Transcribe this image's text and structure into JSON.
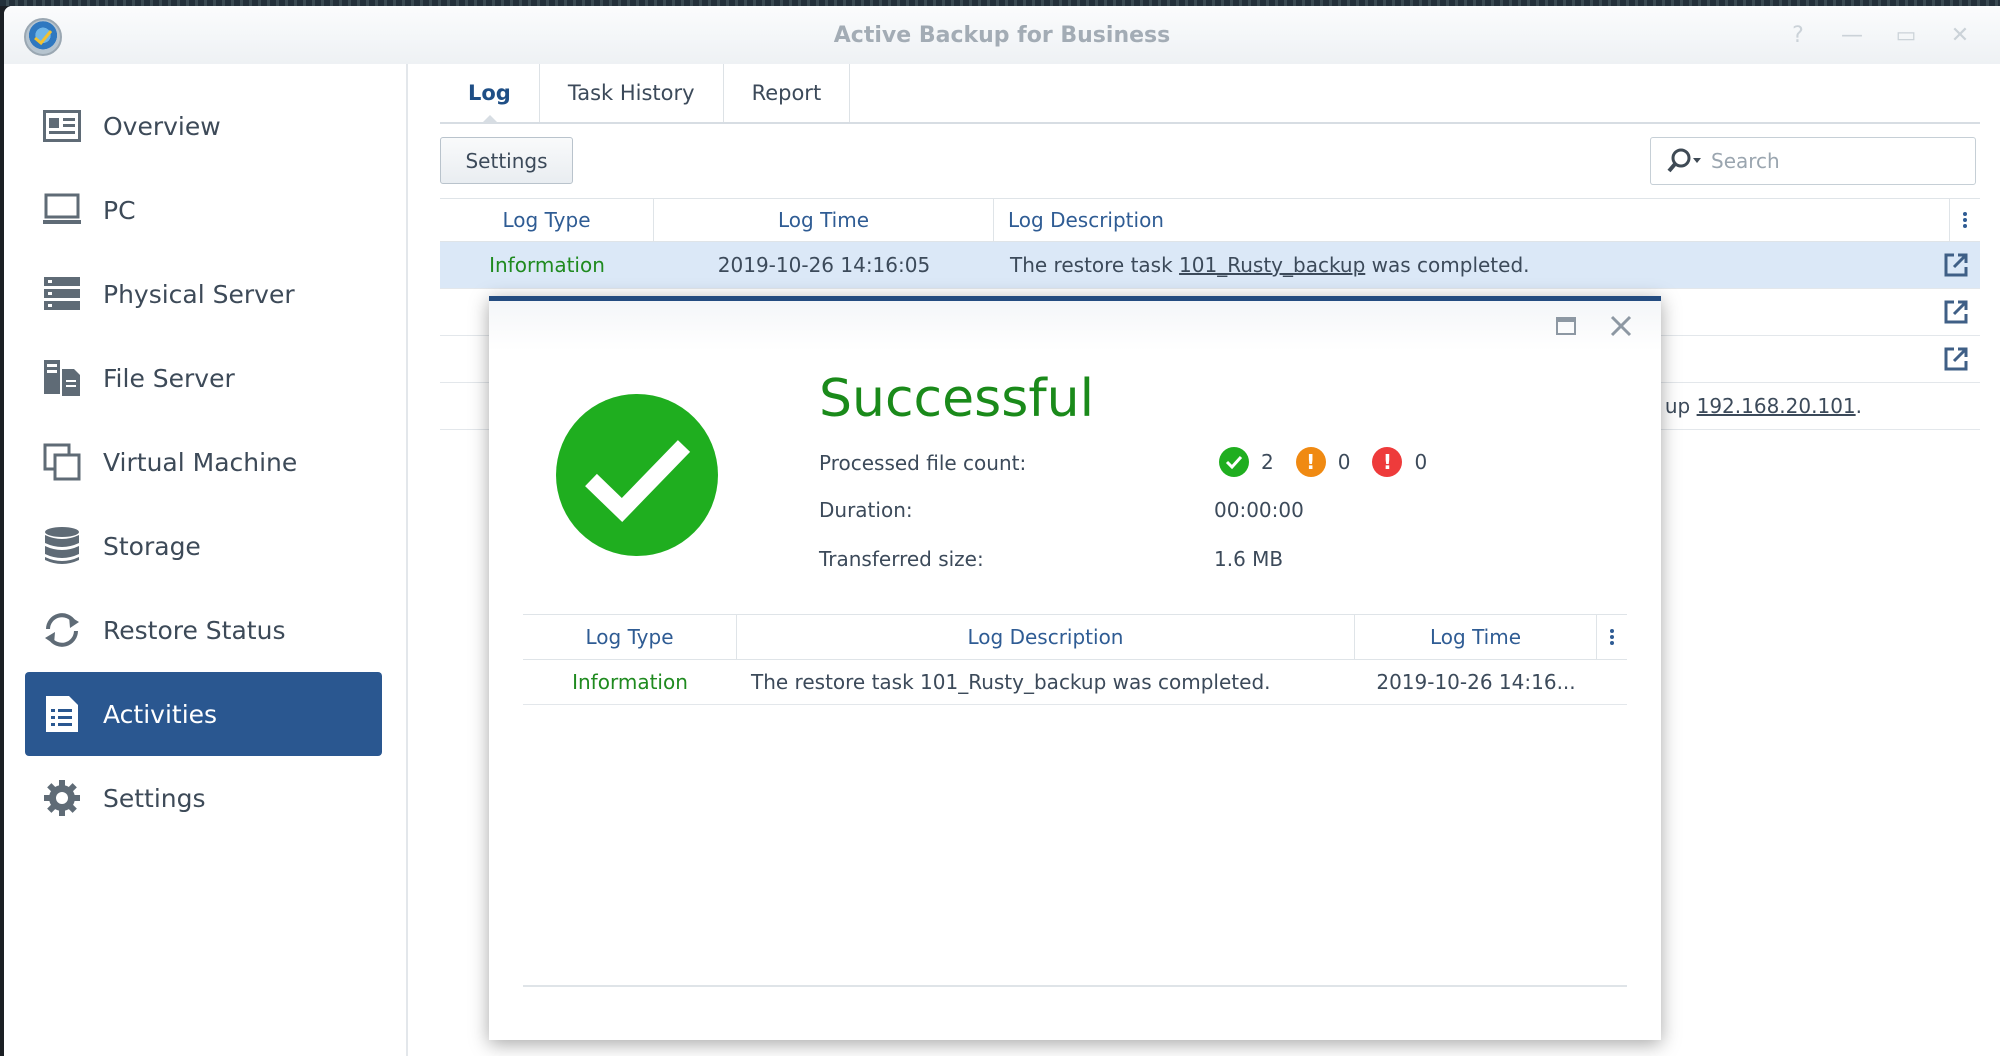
{
  "window": {
    "title": "Active Backup for Business"
  },
  "sidebar": {
    "items": [
      {
        "label": "Overview",
        "icon": "overview-icon"
      },
      {
        "label": "PC",
        "icon": "pc-icon"
      },
      {
        "label": "Physical Server",
        "icon": "physical-server-icon"
      },
      {
        "label": "File Server",
        "icon": "file-server-icon"
      },
      {
        "label": "Virtual Machine",
        "icon": "virtual-machine-icon"
      },
      {
        "label": "Storage",
        "icon": "storage-icon"
      },
      {
        "label": "Restore Status",
        "icon": "restore-status-icon"
      },
      {
        "label": "Activities",
        "icon": "activities-icon",
        "active": true
      },
      {
        "label": "Settings",
        "icon": "settings-gear-icon"
      }
    ]
  },
  "main": {
    "tabs": [
      {
        "label": "Log",
        "active": true
      },
      {
        "label": "Task History"
      },
      {
        "label": "Report"
      }
    ],
    "settings_label": "Settings",
    "search_placeholder": "Search",
    "columns": {
      "type": "Log Type",
      "time": "Log Time",
      "desc": "Log Description"
    },
    "rows": [
      {
        "type": "Information",
        "time": "2019-10-26 14:16:05",
        "desc_prefix": "The restore task ",
        "desc_link": "101_Rusty_backup",
        "desc_suffix": " was completed."
      },
      {
        "desc_tail_prefix": "up ",
        "desc_tail_link": "192.168.20.101",
        "desc_tail_suffix": "."
      }
    ]
  },
  "dialog": {
    "title": "Successful",
    "labels": {
      "processed": "Processed file count:",
      "duration": "Duration:",
      "transferred": "Transferred size:"
    },
    "counts": {
      "success": "2",
      "warning": "0",
      "error": "0"
    },
    "duration": "00:00:00",
    "transferred_size": "1.6 MB",
    "columns": {
      "type": "Log Type",
      "desc": "Log Description",
      "time": "Log Time"
    },
    "rows": [
      {
        "type": "Information",
        "desc": "The restore task 101_Rusty_backup was completed.",
        "time": "2019-10-26 14:16..."
      }
    ]
  },
  "colors": {
    "accent": "#2a5790",
    "success": "#1fae1f",
    "warning": "#f08a12",
    "error": "#ee3b3b",
    "info_text": "#1f8a1f"
  }
}
